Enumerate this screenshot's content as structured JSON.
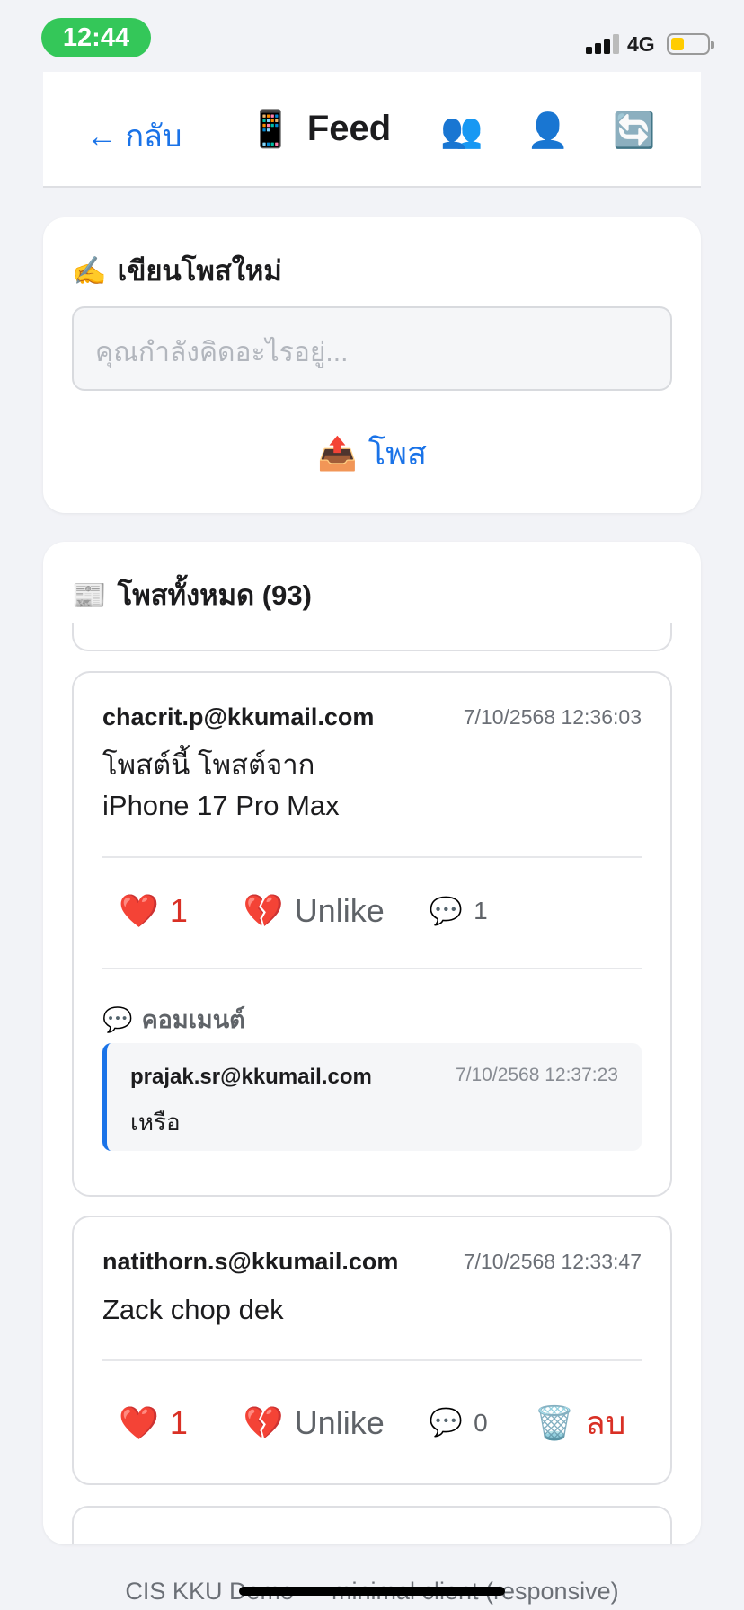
{
  "status_bar": {
    "time": "12:44",
    "network": "4G"
  },
  "header": {
    "back_label": "← กลับ",
    "title_icon": "📱",
    "title": "Feed",
    "icons": [
      "👥",
      "👤",
      "🔄"
    ]
  },
  "composer": {
    "heading_icon": "✍️",
    "heading": "เขียนโพสใหม่",
    "placeholder": "คุณกำลังคิดอะไรอยู่...",
    "post_icon": "📤",
    "post_label": "โพส"
  },
  "feed": {
    "heading_icon": "📰",
    "heading": "โพสทั้งหมด (93)",
    "posts": [
      {
        "author": "chacrit.p@kkumail.com",
        "date": "7/10/2568 12:36:03",
        "body_line1": "โพสต์นี้ โพสต์จาก",
        "body_line2": "iPhone 17 Pro Max",
        "like_icon": "❤️",
        "likes": "1",
        "unlike_icon": "💔",
        "unlike_label": "Unlike",
        "comment_icon": "💬",
        "comment_count": "1",
        "comments_heading": "คอมเมนต์",
        "comments": [
          {
            "author": "prajak.sr@kkumail.com",
            "date": "7/10/2568 12:37:23",
            "text": "เหรือ"
          }
        ]
      },
      {
        "author": "natithorn.s@kkumail.com",
        "date": "7/10/2568 12:33:47",
        "body_line1": "Zack chop dek",
        "like_icon": "❤️",
        "likes": "1",
        "unlike_icon": "💔",
        "unlike_label": "Unlike",
        "comment_icon": "💬",
        "comment_count": "0",
        "delete_icon": "🗑️",
        "delete_label": "ลบ"
      }
    ]
  },
  "footer": {
    "text": "CIS KKU Demo — minimal client (responsive)"
  },
  "colors": {
    "accent": "#1a73e8",
    "danger": "#d93025",
    "status_pill": "#34c759"
  }
}
